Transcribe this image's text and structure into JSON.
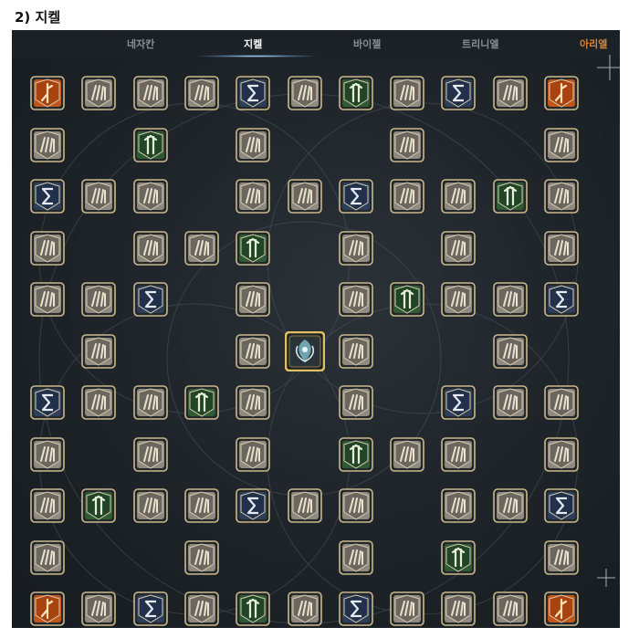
{
  "heading": "2) 지켈",
  "tabs": [
    {
      "label": "네자칸",
      "state": "normal"
    },
    {
      "label": "지켈",
      "state": "active"
    },
    {
      "label": "바이젤",
      "state": "normal"
    },
    {
      "label": "트리니엘",
      "state": "normal"
    },
    {
      "label": "아리엘",
      "state": "accent"
    }
  ],
  "colors": {
    "grey": "#8e8a80",
    "green": "#2e5b33",
    "blue": "#2d3e5a",
    "orange": "#c2561a",
    "frame": "#c9b98c",
    "center_frame": "#e0c061"
  },
  "node_types": {
    "G": "feather-rune-icon",
    "N": "power-rune-icon",
    "B": "sigma-rune-icon",
    "O": "fire-rune-icon"
  },
  "grid": [
    "OGGGBGNGBGO",
    "G.N.G..G..G",
    "BGG.GGBGGNG",
    "G.GGN.G.G.G",
    "GGB.G.GNGGB",
    ".G..GCG..G.",
    "BGGNG.G.BGG",
    "G.G.G.NGG.G",
    "GNGGBGG.GGB",
    "G..G..G.N.G",
    "OGBGNGBGGGO"
  ],
  "center": {
    "name": "zikel-crest-icon"
  }
}
